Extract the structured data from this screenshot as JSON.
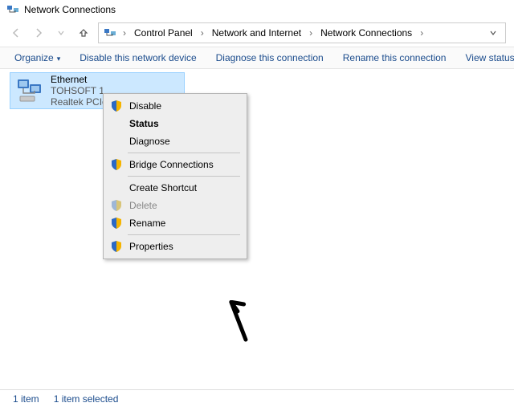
{
  "window": {
    "title": "Network Connections"
  },
  "breadcrumbs": {
    "panel": "Control Panel",
    "netinet": "Network and Internet",
    "netconn": "Network Connections"
  },
  "toolbar": {
    "organize": "Organize",
    "disable": "Disable this network device",
    "diagnose": "Diagnose this connection",
    "rename": "Rename this connection",
    "view_status": "View status of this conne"
  },
  "connection": {
    "name": "Ethernet",
    "network": "TOHSOFT 1",
    "adapter": "Realtek PCIe"
  },
  "ctx": {
    "disable": "Disable",
    "status": "Status",
    "diagnose": "Diagnose",
    "bridge": "Bridge Connections",
    "shortcut": "Create Shortcut",
    "delete": "Delete",
    "rename": "Rename",
    "properties": "Properties"
  },
  "status": {
    "count": "1 item",
    "selected": "1 item selected"
  }
}
